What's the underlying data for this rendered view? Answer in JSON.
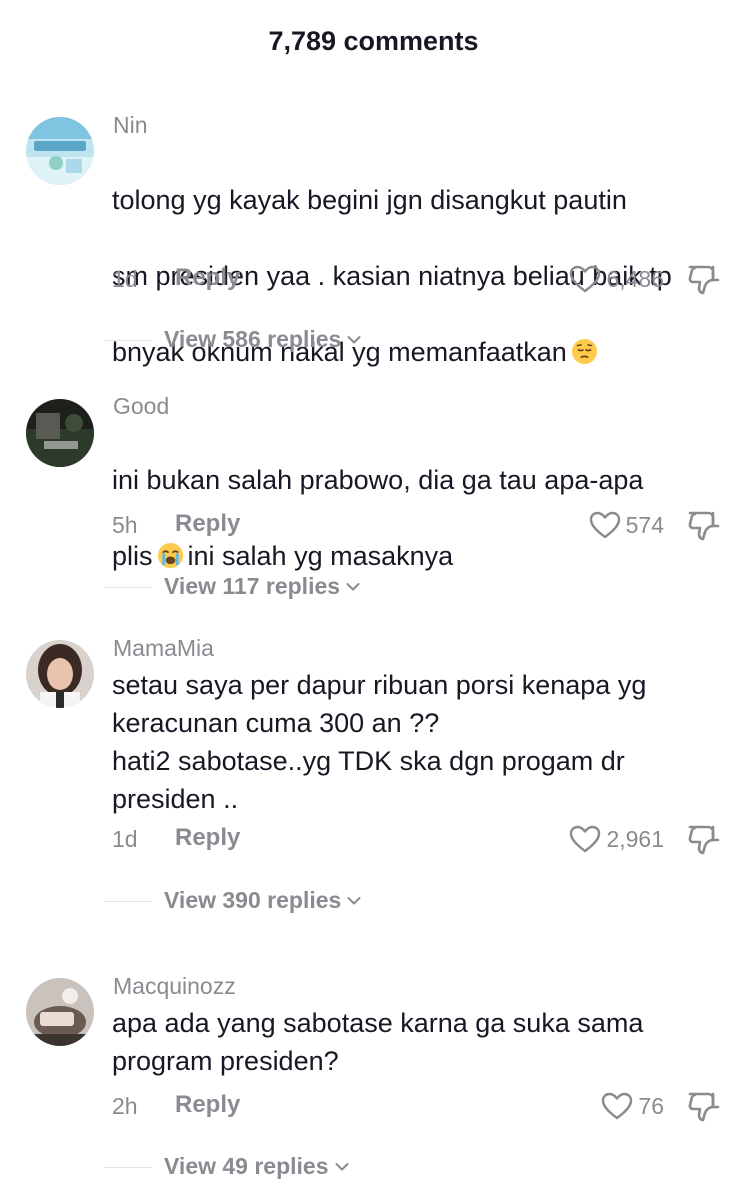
{
  "header": {
    "title": "7,789 comments"
  },
  "comments": [
    {
      "username": "Nin",
      "text_lines": [
        "tolong yg kayak begini jgn disangkut pautin",
        "sm presiden yaa . kasian niatnya beliau baik tp",
        "bnyak oknum nakal yg memanfaatkan"
      ],
      "emoji": "pensive-face-emoji",
      "time": "1d",
      "reply_label": "Reply",
      "likes": "6,486",
      "view_replies": "View 586 replies"
    },
    {
      "username": "Good",
      "text_line1": "ini bukan salah prabowo, dia ga tau apa-apa",
      "text_line2_a": "plis",
      "text_line2_b": "ini salah yg masaknya",
      "emoji": "loudly-crying-face-emoji",
      "time": "5h",
      "reply_label": "Reply",
      "likes": "574",
      "view_replies": "View 117 replies"
    },
    {
      "username": "MamaMia",
      "text": "setau saya per dapur ribuan porsi kenapa yg\nkeracunan cuma 300 an ??\nhati2 sabotase..yg TDK ska dgn progam dr\npresiden ..",
      "time": "1d",
      "reply_label": "Reply",
      "likes": "2,961",
      "view_replies": "View 390 replies"
    },
    {
      "username": "Macquinozz",
      "text": "apa ada yang sabotase karna ga suka sama\nprogram presiden?",
      "time": "2h",
      "reply_label": "Reply",
      "likes": "76",
      "view_replies": "View 49 replies"
    }
  ],
  "icons": {
    "like": "heart-outline-icon",
    "dislike": "thumbs-down-outline-icon",
    "expand": "chevron-down-icon"
  },
  "colors": {
    "text_primary": "#161823",
    "text_secondary": "#8a8b91",
    "divider": "#e3e3e4"
  }
}
